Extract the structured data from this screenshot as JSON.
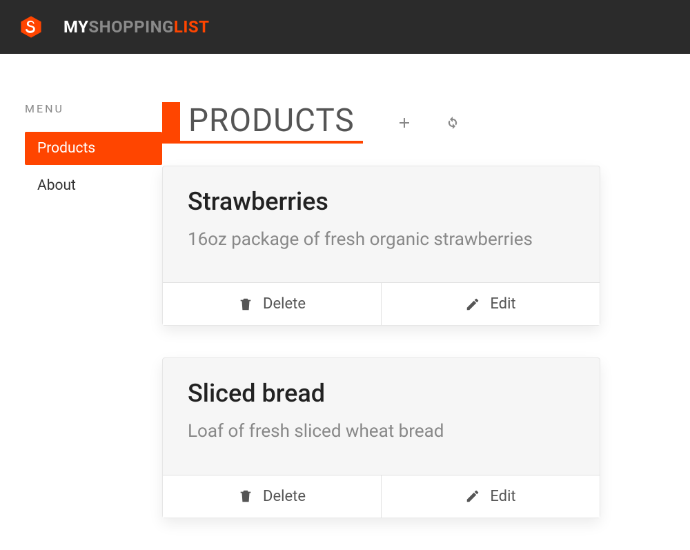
{
  "brand": {
    "part1": "MY",
    "part2": "SHOPPING",
    "part3": "LIST"
  },
  "sidebar": {
    "menu_label": "MENU",
    "items": [
      {
        "label": "Products",
        "active": true
      },
      {
        "label": "About",
        "active": false
      }
    ]
  },
  "page": {
    "title": "PRODUCTS"
  },
  "actions": {
    "delete_label": "Delete",
    "edit_label": "Edit"
  },
  "products": [
    {
      "name": "Strawberries",
      "description": "16oz package of fresh organic strawberries"
    },
    {
      "name": "Sliced bread",
      "description": "Loaf of fresh sliced wheat bread"
    }
  ]
}
